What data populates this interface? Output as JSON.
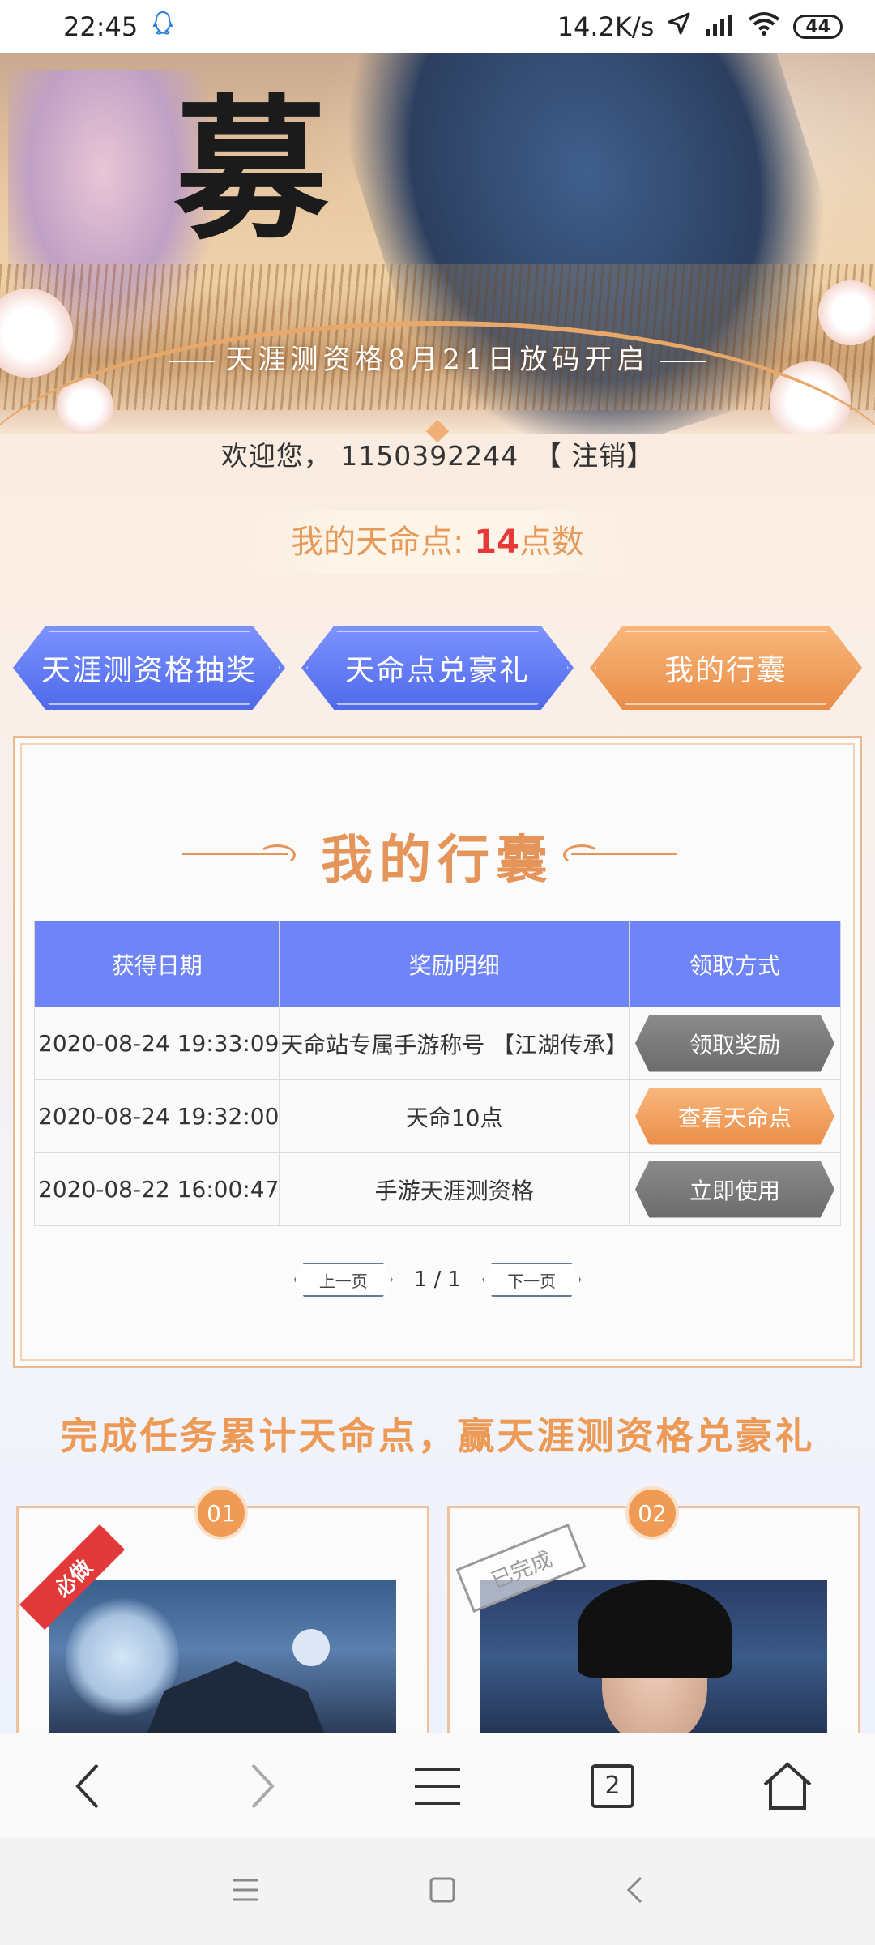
{
  "status_bar": {
    "time": "22:45",
    "network_speed": "14.2K/s",
    "battery": "44"
  },
  "hero": {
    "calligraphy": "募",
    "banner_text": "天涯测资格8月21日放码开启"
  },
  "welcome": {
    "prefix": "欢迎您，",
    "account": "1150392244",
    "logout_label": "【 注销】"
  },
  "points": {
    "label": "我的天命点:",
    "value": "14",
    "unit": "点数"
  },
  "tabs": [
    {
      "label": "天涯测资格抽奖",
      "active": false
    },
    {
      "label": "天命点兑豪礼",
      "active": false
    },
    {
      "label": "我的行囊",
      "active": true
    }
  ],
  "bag": {
    "title": "我的行囊",
    "columns": [
      "获得日期",
      "奖励明细",
      "领取方式"
    ],
    "rows": [
      {
        "date": "2020-08-24 19:33:09",
        "detail": "天命站专属手游称号 【江湖传承】",
        "action": "领取奖励",
        "style": "gray"
      },
      {
        "date": "2020-08-24 19:32:00",
        "detail": "天命10点",
        "action": "查看天命点",
        "style": "orange"
      },
      {
        "date": "2020-08-22 16:00:47",
        "detail": "手游天涯测资格",
        "action": "立即使用",
        "style": "gray"
      }
    ],
    "pager": {
      "prev": "上一页",
      "page": "1 / 1",
      "next": "下一页"
    }
  },
  "tasks": {
    "title": "完成任务累计天命点，赢天涯测资格兑豪礼",
    "items": [
      {
        "num": "01",
        "badge": "必做"
      },
      {
        "num": "02",
        "stamp": "已完成"
      }
    ]
  },
  "browser_nav": {
    "tab_count": "2"
  },
  "colors": {
    "accent_orange": "#ec8e49",
    "accent_blue": "#6e84f7",
    "points_red": "#e8393a"
  }
}
